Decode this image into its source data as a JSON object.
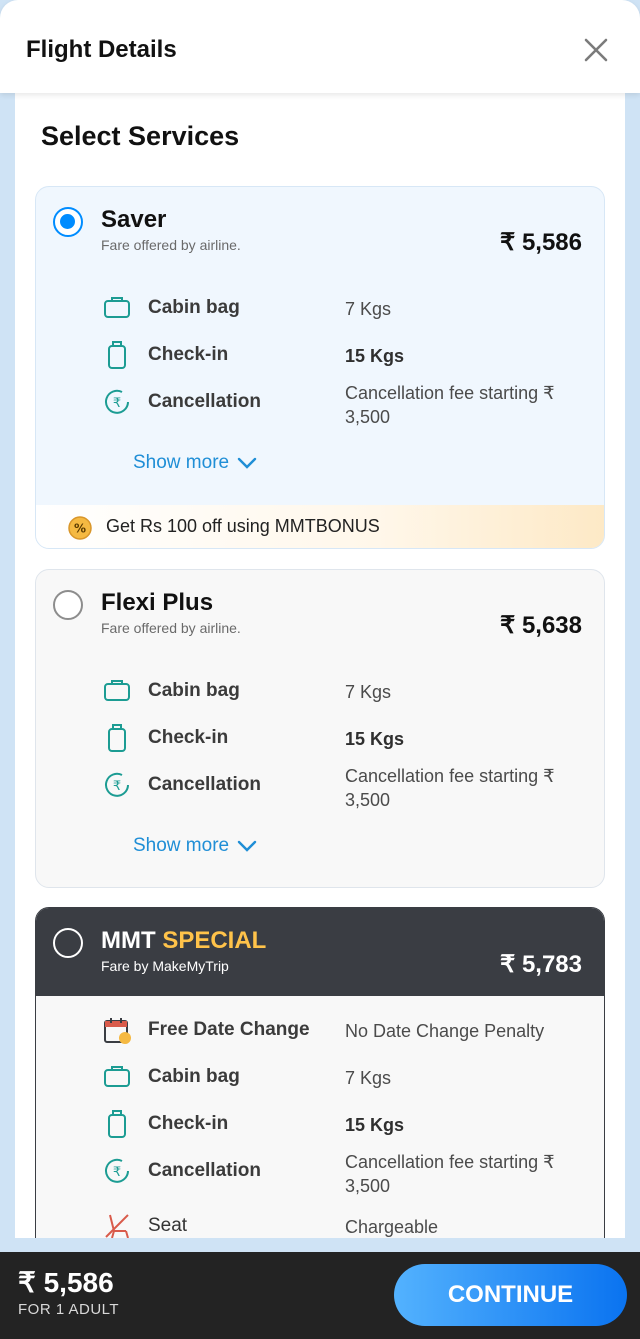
{
  "header": {
    "title": "Flight Details",
    "close_icon": "close-icon"
  },
  "section_title": "Select Services",
  "fares": [
    {
      "name": "Saver",
      "subtitle": "Fare offered by airline.",
      "price": "₹ 5,586",
      "selected": true,
      "rows": [
        {
          "icon": "cabin-bag-icon",
          "label": "Cabin bag",
          "value": "7 Kgs"
        },
        {
          "icon": "check-in-bag-icon",
          "label": "Check-in",
          "value": "15 Kgs"
        },
        {
          "icon": "cancellation-icon",
          "label": "Cancellation",
          "value": "Cancellation fee starting ₹ 3,500"
        }
      ],
      "show_more": "Show more",
      "promo": "Get Rs 100 off using MMTBONUS"
    },
    {
      "name": "Flexi Plus",
      "subtitle": "Fare offered by airline.",
      "price": "₹ 5,638",
      "selected": false,
      "rows": [
        {
          "icon": "cabin-bag-icon",
          "label": "Cabin bag",
          "value": "7 Kgs"
        },
        {
          "icon": "check-in-bag-icon",
          "label": "Check-in",
          "value": "15 Kgs"
        },
        {
          "icon": "cancellation-icon",
          "label": "Cancellation",
          "value": "Cancellation fee starting ₹ 3,500"
        }
      ],
      "show_more": "Show more"
    },
    {
      "name_part1": "MMT",
      "name_part2": "SPECIAL",
      "subtitle": "Fare by MakeMyTrip",
      "price": "₹ 5,783",
      "selected": false,
      "rows": [
        {
          "icon": "calendar-icon",
          "label": "Free Date Change",
          "value": "No Date Change Penalty"
        },
        {
          "icon": "cabin-bag-icon",
          "label": "Cabin bag",
          "value": "7 Kgs"
        },
        {
          "icon": "check-in-bag-icon",
          "label": "Check-in",
          "value": "15 Kgs"
        },
        {
          "icon": "cancellation-icon",
          "label": "Cancellation",
          "value": "Cancellation fee starting ₹ 3,500"
        },
        {
          "icon": "seat-icon",
          "label": "Seat",
          "value": "Chargeable"
        }
      ]
    }
  ],
  "footer": {
    "total_price": "₹ 5,586",
    "total_sub": "FOR 1 ADULT",
    "continue_label": "CONTINUE"
  },
  "colors": {
    "accent_blue": "#008cff",
    "link_blue": "#1f8ed6",
    "special_yellow": "#ffc34a",
    "dark_header": "#3a3d43",
    "icon_teal": "#1c9c93"
  }
}
